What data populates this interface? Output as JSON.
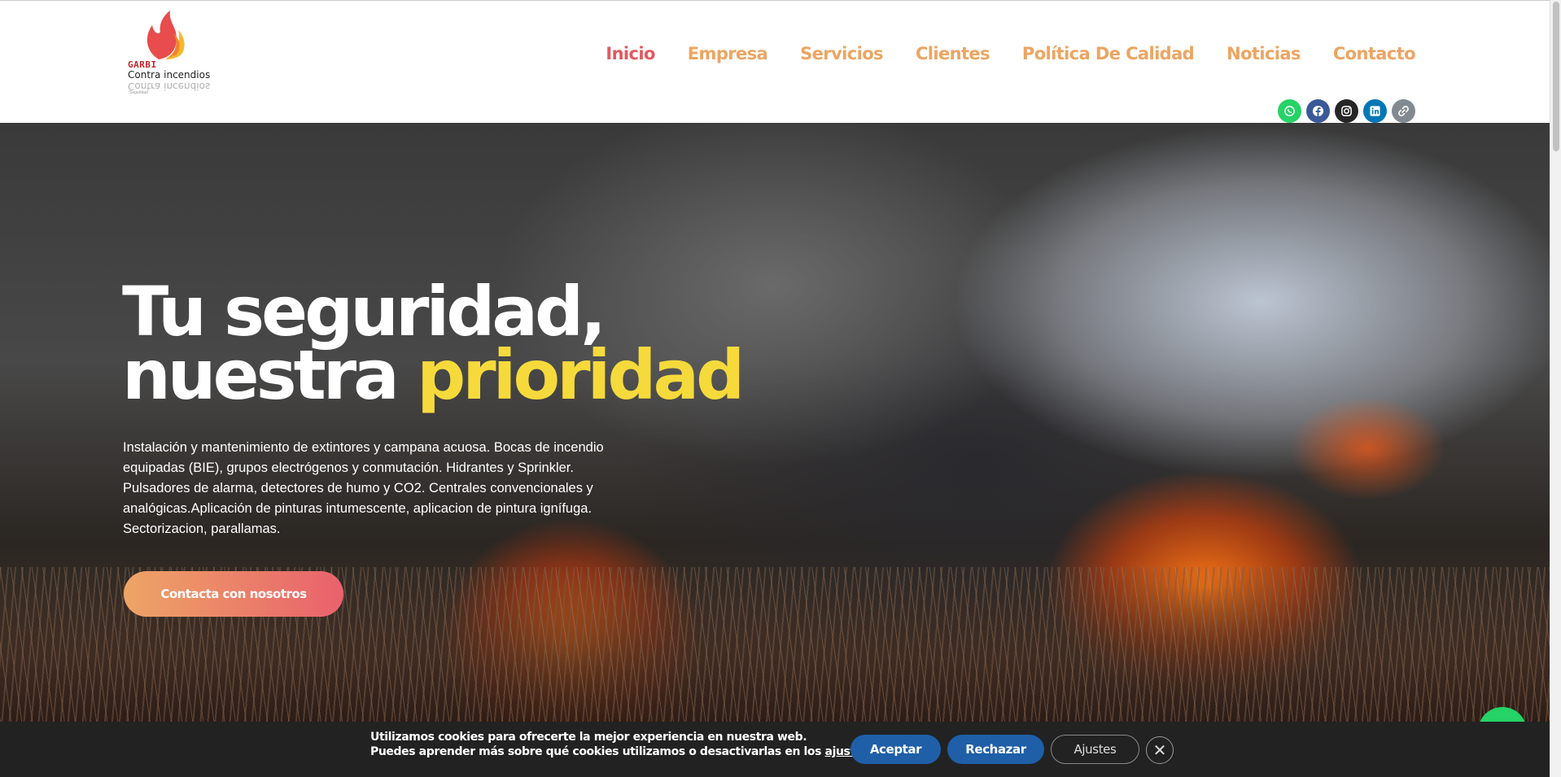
{
  "logo": {
    "brand": "GARBI",
    "subtitle": "Contra incendios",
    "small": "Seguridad"
  },
  "nav": {
    "items": [
      {
        "label": "Inicio",
        "active": true
      },
      {
        "label": "Empresa"
      },
      {
        "label": "Servicios"
      },
      {
        "label": "Clientes"
      },
      {
        "label": "Política De Calidad"
      },
      {
        "label": "Noticias"
      },
      {
        "label": "Contacto"
      }
    ]
  },
  "social": {
    "icons": [
      "whatsapp-icon",
      "facebook-icon",
      "instagram-icon",
      "linkedin-icon",
      "link-icon"
    ]
  },
  "hero": {
    "title_line1": "Tu seguridad,",
    "title_line2_a": "nuestra",
    "title_line2_b": "prioridad",
    "description": "Instalación y mantenimiento de extintores y campana acuosa. Bocas de incendio equipadas (BIE), grupos electrógenos y conmutación. Hidrantes y Sprinkler. Pulsadores de alarma, detectores de humo y CO2. Centrales convencionales y analógicas.Aplicación de pinturas intumescente, aplicacion de pintura ignífuga. Sectorizacion, parallamas.",
    "cta": "Contacta con nosotros"
  },
  "cookie": {
    "line1": "Utilizamos cookies para ofrecerte la mejor experiencia en nuestra web.",
    "line2_prefix": "Puedes aprender más sobre qué cookies utilizamos o desactivarlas en los ",
    "line2_link": "ajustes",
    "line2_suffix": ".",
    "accept": "Aceptar",
    "reject": "Rechazar",
    "settings": "Ajustes",
    "close": "✕"
  },
  "colors": {
    "accent_yellow": "#f6da3c",
    "nav_orange": "#eca562",
    "nav_active": "#e3585f",
    "cookie_btn": "#1e5fa8"
  }
}
